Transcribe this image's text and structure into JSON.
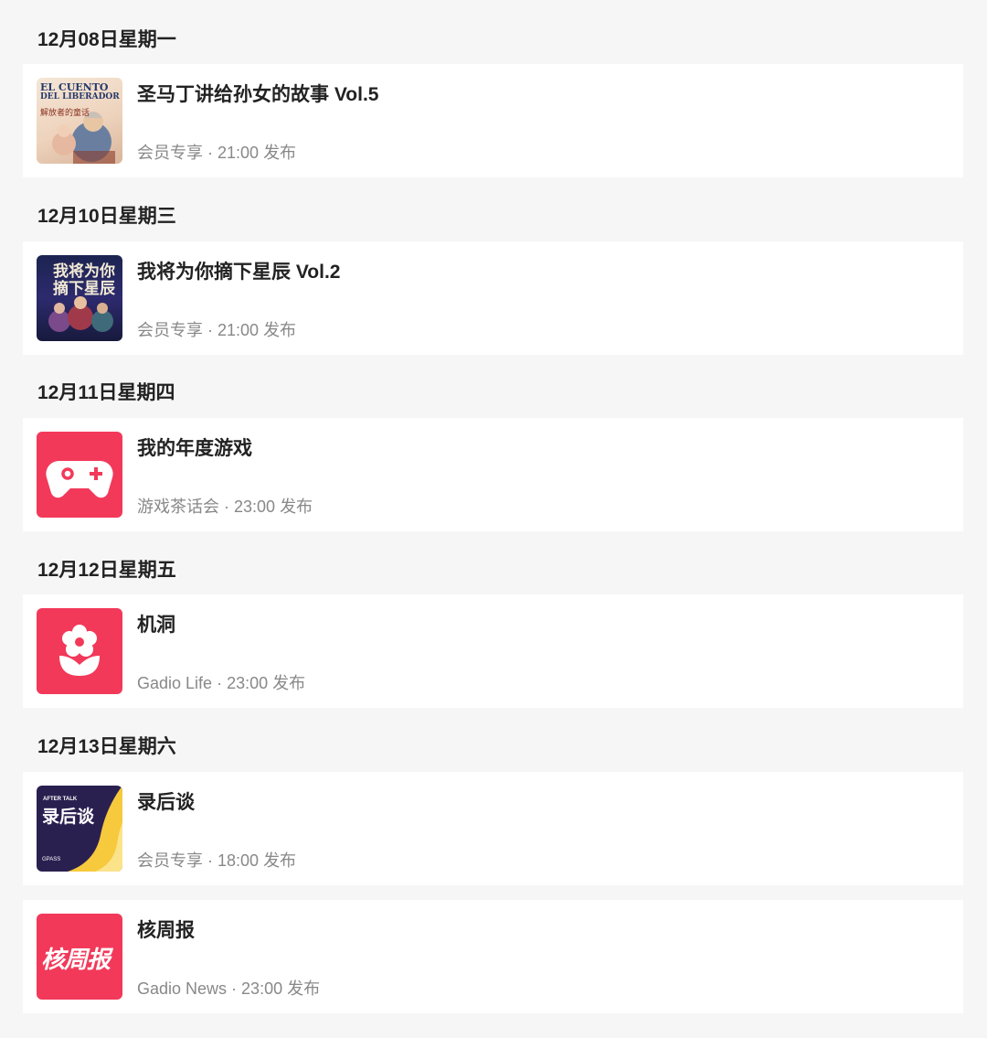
{
  "schedule": [
    {
      "date": "12月08日星期一",
      "episodes": [
        {
          "title": "圣马丁讲给孙女的故事 Vol.5",
          "channel": "会员专享",
          "time": "21:00",
          "publish": "发布",
          "cover": {
            "line1": "EL CUENTO",
            "line2": "DEL LIBERADOR",
            "line3": "解放者的童话"
          }
        }
      ]
    },
    {
      "date": "12月10日星期三",
      "episodes": [
        {
          "title": "我将为你摘下星辰 Vol.2",
          "channel": "会员专享",
          "time": "21:00",
          "publish": "发布",
          "cover": {
            "line1": "我将为你",
            "line2": "摘下星辰"
          }
        }
      ]
    },
    {
      "date": "12月11日星期四",
      "episodes": [
        {
          "title": "我的年度游戏",
          "channel": "游戏茶话会",
          "time": "23:00",
          "publish": "发布",
          "icon": "gamepad-icon"
        }
      ]
    },
    {
      "date": "12月12日星期五",
      "episodes": [
        {
          "title": "机洞",
          "channel": "Gadio Life",
          "time": "23:00",
          "publish": "发布",
          "icon": "flower-icon"
        }
      ]
    },
    {
      "date": "12月13日星期六",
      "episodes": [
        {
          "title": "录后谈",
          "channel": "会员专享",
          "time": "18:00",
          "publish": "发布",
          "cover": {
            "line1": "AFTER TALK",
            "line2": "录后谈",
            "line3": "GPASS"
          }
        },
        {
          "title": "核周报",
          "channel": "Gadio News",
          "time": "23:00",
          "publish": "发布",
          "cover": {
            "line1": "核周报"
          }
        }
      ]
    }
  ],
  "colors": {
    "accent": "#f2395a",
    "background": "#f6f6f6",
    "card": "#ffffff",
    "meta": "#888888"
  }
}
